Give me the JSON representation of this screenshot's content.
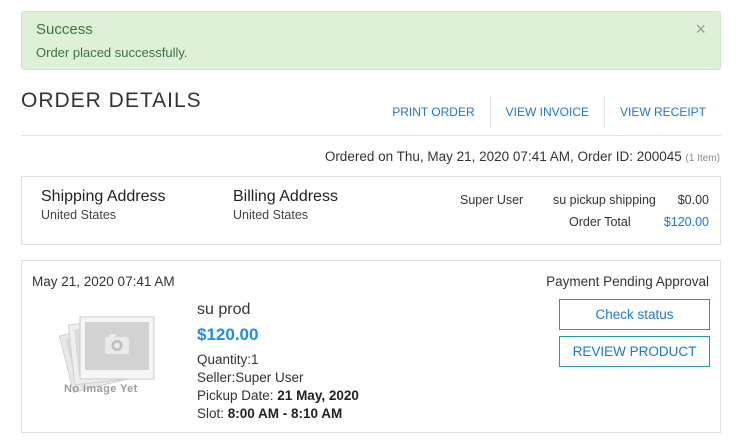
{
  "alert": {
    "title": "Success",
    "message": "Order placed successfully.",
    "close": "×"
  },
  "header": {
    "title": "ORDER DETAILS",
    "actions": [
      "PRINT ORDER",
      "VIEW INVOICE",
      "VIEW RECEIPT"
    ]
  },
  "order": {
    "ordered_text": "Ordered on Thu, May 21, 2020 07:41 AM, Order ID: 200045",
    "items_count": "(1 Item)"
  },
  "addresses": {
    "shipping_title": "Shipping Address",
    "shipping_country": "United States",
    "billing_title": "Billing Address",
    "billing_country": "United States"
  },
  "summary": {
    "user": "Super User",
    "shipping_label": "su pickup shipping",
    "shipping_price": "$0.00",
    "total_label": "Order Total",
    "total_value": "$120.00"
  },
  "item": {
    "date": "May 21, 2020 07:41 AM",
    "status": "Payment Pending Approval",
    "no_image": "No Image Yet",
    "name": "su prod",
    "price": "$120.00",
    "quantity": "Quantity:1",
    "seller": "Seller:Super User",
    "pickup_label": "Pickup Date: ",
    "pickup_value": "21 May, 2020",
    "slot_label": "Slot: ",
    "slot_value": "8:00 AM - 8:10 AM",
    "check_status": "Check status",
    "review": "REVIEW PRODUCT"
  },
  "colors": {
    "success_bg": "#dff0d8",
    "success_text": "#3c763d",
    "link": "#1f78c8",
    "price": "#1f8de0",
    "button_border": "#2a9d9a"
  }
}
